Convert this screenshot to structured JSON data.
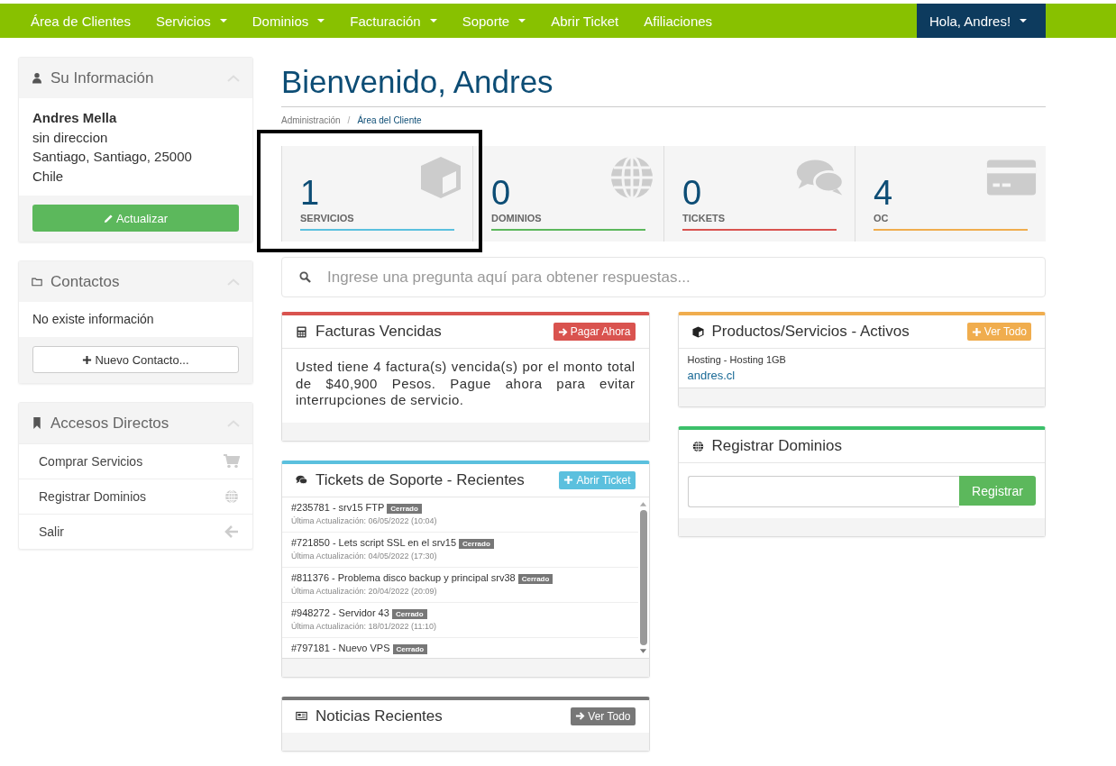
{
  "nav": {
    "items": [
      {
        "label": "Área de Clientes",
        "dropdown": false
      },
      {
        "label": "Servicios",
        "dropdown": true
      },
      {
        "label": "Dominios",
        "dropdown": true
      },
      {
        "label": "Facturación",
        "dropdown": true
      },
      {
        "label": "Soporte",
        "dropdown": true
      },
      {
        "label": "Abrir Ticket",
        "dropdown": false
      },
      {
        "label": "Afiliaciones",
        "dropdown": false
      }
    ],
    "user": {
      "label": "Hola, Andres!",
      "dropdown": true
    }
  },
  "sidebar": {
    "info": {
      "title": "Su Información",
      "name": "Andres Mella",
      "lines": [
        "sin direccion",
        "Santiago, Santiago, 25000",
        "Chile"
      ],
      "button": "Actualizar"
    },
    "contacts": {
      "title": "Contactos",
      "empty_text": "No existe información",
      "button": "Nuevo Contacto..."
    },
    "shortcuts": {
      "title": "Accesos Directos",
      "items": [
        {
          "label": "Comprar Servicios",
          "kind": "cart"
        },
        {
          "label": "Registrar Dominios",
          "kind": "globe"
        },
        {
          "label": "Salir",
          "kind": "back"
        }
      ]
    }
  },
  "main": {
    "title": "Bienvenido, Andres",
    "breadcrumb_separator": "/",
    "breadcrumb": [
      {
        "label": "Administración",
        "active": false
      },
      {
        "label": "Área del Cliente",
        "active": true
      }
    ],
    "stats": [
      {
        "count": "1",
        "label": "SERVICIOS",
        "color": "#5bc0de",
        "kind": "cube",
        "highlighted": true
      },
      {
        "count": "0",
        "label": "DOMINIOS",
        "color": "#5cb85c",
        "kind": "globe",
        "highlighted": false
      },
      {
        "count": "0",
        "label": "TICKETS",
        "color": "#d9534f",
        "kind": "comments",
        "highlighted": false
      },
      {
        "count": "4",
        "label": "OC",
        "color": "#f0ad4e",
        "kind": "card",
        "highlighted": false
      }
    ],
    "search": {
      "placeholder": "Ingrese una pregunta aquí para obtener respuestas..."
    },
    "left_column": [
      {
        "kind": "invoices",
        "title": "Facturas Vencidas",
        "color": "#d9534f",
        "button": {
          "label": "Pagar Ahora",
          "kind": "arrow"
        },
        "text": "Usted tiene 4 factura(s) vencida(s) por el monto total de $40,900 Pesos. Pague ahora para evitar interrupciones de servicio."
      },
      {
        "kind": "tickets",
        "title": "Tickets de Soporte - Recientes",
        "color": "#5bc0de",
        "button": {
          "label": "Abrir Ticket",
          "kind": "plus"
        },
        "tickets": [
          {
            "title": "#235781 - srv15 FTP",
            "status": "Cerrado",
            "updated": "Última Actualización: 06/05/2022 (10:04)"
          },
          {
            "title": "#721850 - Lets script SSL en el srv15",
            "status": "Cerrado",
            "updated": "Última Actualización: 04/05/2022 (17:30)"
          },
          {
            "title": "#811376 - Problema disco backup y principal srv38",
            "status": "Cerrado",
            "updated": "Última Actualización: 20/04/2022 (20:09)"
          },
          {
            "title": "#948272 - Servidor 43",
            "status": "Cerrado",
            "updated": "Última Actualización: 18/01/2022 (11:10)"
          },
          {
            "title": "#797181 - Nuevo VPS",
            "status": "Cerrado"
          }
        ]
      },
      {
        "kind": "news",
        "title": "Noticias Recientes",
        "color": "#777777",
        "button": {
          "label": "Ver Todo",
          "kind": "arrow"
        }
      }
    ],
    "right_column": [
      {
        "kind": "products",
        "title": "Productos/Servicios - Activos",
        "color": "#f0ad4e",
        "button": {
          "label": "Ver Todo",
          "kind": "plus"
        },
        "products": [
          {
            "name": "Hosting - Hosting 1GB",
            "domain": "andres.cl"
          }
        ]
      },
      {
        "kind": "domains",
        "title": "Registrar Dominios",
        "color": "#3cc06a",
        "register_button": "Registrar"
      }
    ]
  }
}
